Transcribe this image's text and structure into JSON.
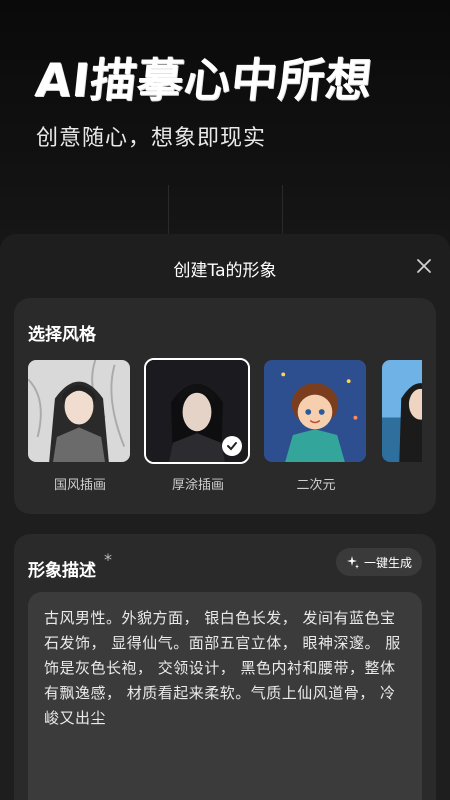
{
  "hero": {
    "title": "AI描摹心中所想",
    "subtitle": "创意随心，想象即现实"
  },
  "sheet": {
    "title": "创建Ta的形象",
    "close_icon": "close-icon"
  },
  "style_section": {
    "title": "选择风格",
    "items": [
      {
        "label": "国风插画",
        "selected": false
      },
      {
        "label": "厚涂插画",
        "selected": true
      },
      {
        "label": "二次元",
        "selected": false
      },
      {
        "label": "",
        "selected": false
      }
    ]
  },
  "description": {
    "title": "形象描述",
    "required_mark": "*",
    "ai_button_label": "一键生成",
    "text": "古风男性。外貌方面， 银白色长发， 发间有蓝色宝石发饰， 显得仙气。面部五官立体， 眼神深邃。 服饰是灰色长袍， 交领设计， 黑色内衬和腰带，整体有飘逸感， 材质看起来柔软。气质上仙风道骨， 冷峻又出尘"
  },
  "colors": {
    "accent": "#ffffff",
    "card_bg": "#2a2a2a",
    "sheet_bg": "#1e1e1e"
  }
}
